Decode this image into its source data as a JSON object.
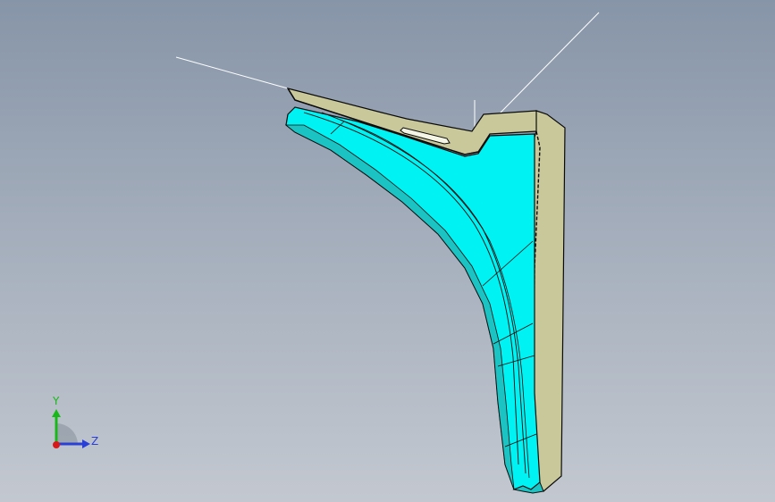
{
  "view": {
    "type": "3d-cad-viewport",
    "background_top": "#8795a8",
    "background_bottom": "#c3c8d0"
  },
  "model": {
    "shape": "curved bracket part",
    "face_colors": {
      "curved_surface": "#00f2f2",
      "curved_surface_shade": "#1cc3c3",
      "flat_surfaces": "#c8c89a",
      "flat_surfaces_shade": "#a8a878",
      "edges": "#0a0a0a"
    }
  },
  "triad": {
    "y_label": "Y",
    "z_label": "Z",
    "y_color": "#18b818",
    "z_color": "#2a3fd8",
    "x_color": "#d81818"
  }
}
